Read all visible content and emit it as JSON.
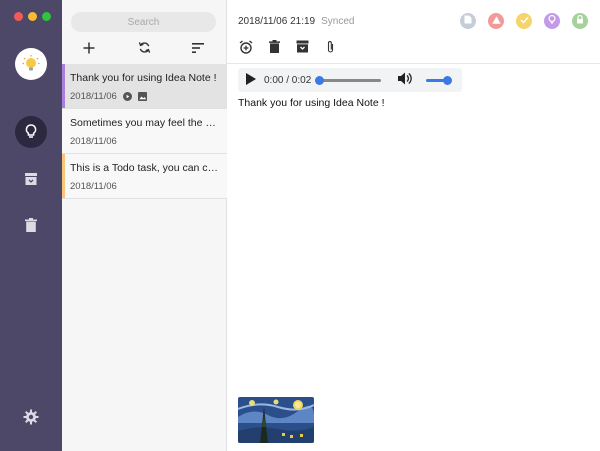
{
  "window": {
    "traffic_lights": [
      "close",
      "minimize",
      "maximize"
    ]
  },
  "sidebar": {
    "logo_icon": "lightbulb-logo-icon",
    "items": [
      {
        "name": "ideas",
        "icon": "lightbulb-icon",
        "active": true
      },
      {
        "name": "archive",
        "icon": "archive-icon",
        "active": false
      },
      {
        "name": "trash",
        "icon": "trash-icon",
        "active": false
      }
    ],
    "settings_icon": "gear-icon",
    "bg_color": "#4e4868"
  },
  "list": {
    "search_placeholder": "Search",
    "toolbar": [
      "add-icon",
      "sync-icon",
      "sort-icon"
    ],
    "notes": [
      {
        "title": "Thank you for using Idea Note !",
        "date": "2018/11/06",
        "selected": true,
        "color": "#a87fdc",
        "has_audio": true,
        "has_image": true
      },
      {
        "title": "Sometimes you may feel the mo...",
        "date": "2018/11/06",
        "selected": false,
        "color": "",
        "has_audio": false,
        "has_image": false
      },
      {
        "title": "This is a Todo task, you can che...",
        "date": "2018/11/06",
        "selected": false,
        "color": "#f6c57a",
        "has_audio": false,
        "has_image": false
      }
    ]
  },
  "editor": {
    "datetime": "2018/11/06 21:19",
    "sync_status": "Synced",
    "color_tags": [
      {
        "name": "grey",
        "color": "#c5ced8",
        "icon": "document-icon"
      },
      {
        "name": "red",
        "color": "#f29a9a",
        "icon": "warning-icon"
      },
      {
        "name": "yellow",
        "color": "#f7d46a",
        "icon": "check-icon"
      },
      {
        "name": "purple",
        "color": "#c49ae8",
        "icon": "bulb-icon"
      },
      {
        "name": "green",
        "color": "#a6d19a",
        "icon": "lock-icon"
      }
    ],
    "toolbar": [
      "alarm-icon",
      "delete-icon",
      "archive-icon",
      "attachment-icon"
    ],
    "audio": {
      "time": "0:00 / 0:02",
      "progress": 0.0,
      "volume": 1.0
    },
    "content": "Thank you for using Idea Note !",
    "attachment": "starry-night-image"
  }
}
